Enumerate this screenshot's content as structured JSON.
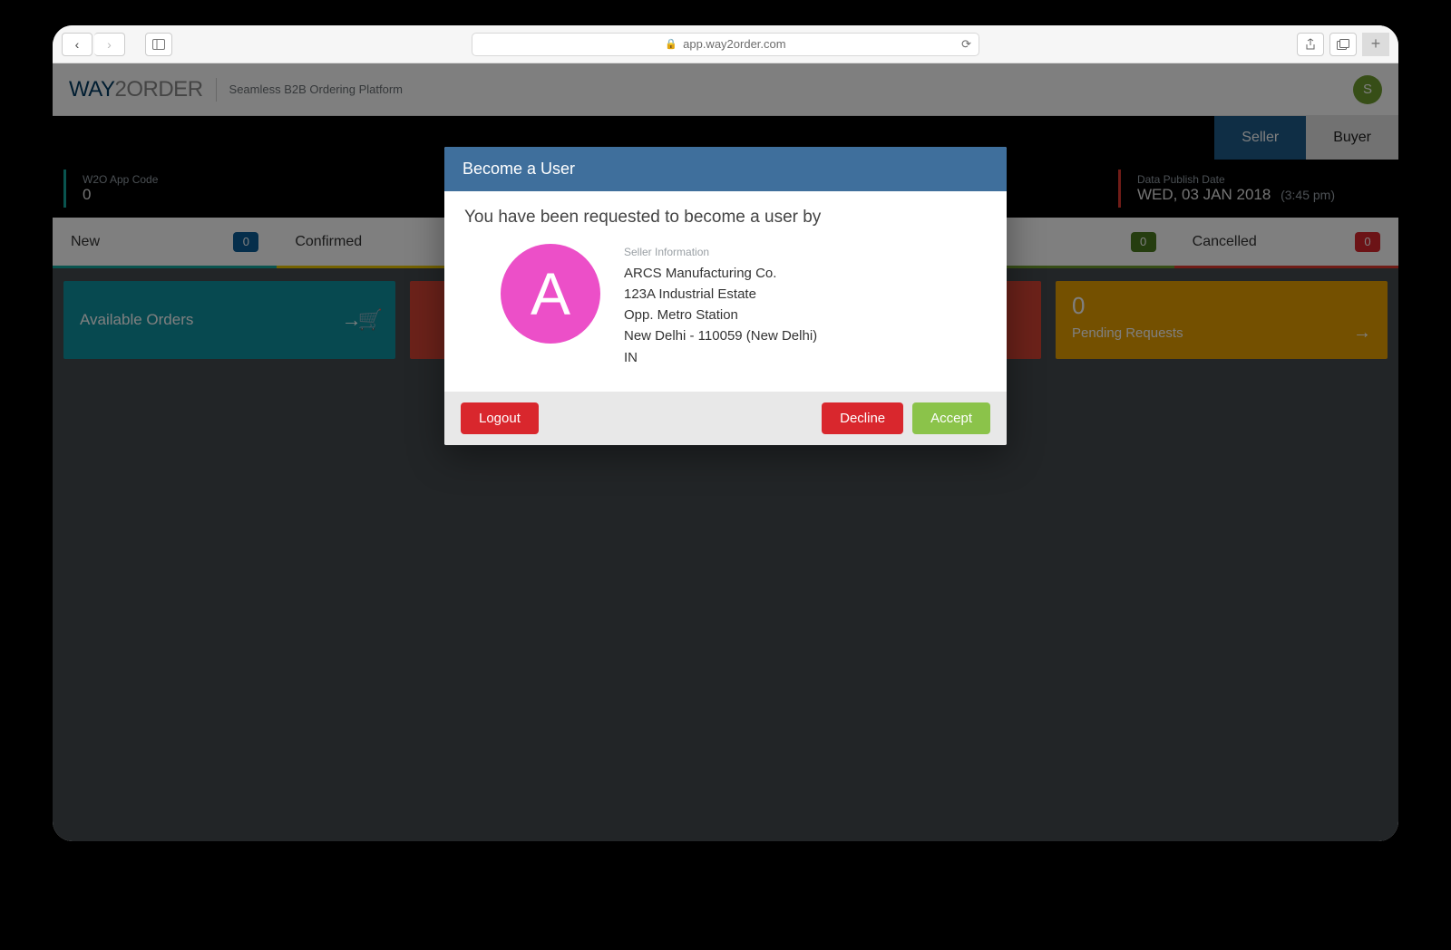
{
  "browser": {
    "address": "app.way2order.com"
  },
  "header": {
    "logo_main": "WAY",
    "logo_rest": "2ORDER",
    "tagline": "Seamless B2B Ordering Platform",
    "avatar_letter": "S"
  },
  "role_tabs": {
    "seller": "Seller",
    "buyer": "Buyer"
  },
  "info": {
    "app_code_label": "W2O App Code",
    "app_code_value": "0",
    "publish_label": "Data Publish Date",
    "publish_date": "WED, 03 JAN 2018",
    "publish_time": "(3:45 pm)"
  },
  "tabs": {
    "new": {
      "label": "New",
      "count": "0"
    },
    "confirmed": {
      "label": "Confirmed",
      "count": ""
    },
    "other_count": "0",
    "cancelled": {
      "label": "Cancelled",
      "count": "0"
    }
  },
  "tiles": {
    "available_label": "Available Orders",
    "pending_value": "0",
    "pending_label": "Pending Requests"
  },
  "modal": {
    "title": "Become a User",
    "message": "You have been requested to become a user by",
    "avatar_letter": "A",
    "seller_header": "Seller Information",
    "seller_name": "ARCS Manufacturing Co.",
    "addr1": "123A Industrial Estate",
    "addr2": "Opp. Metro Station",
    "addr3": "New Delhi - 110059 (New Delhi)",
    "country": "IN",
    "logout": "Logout",
    "decline": "Decline",
    "accept": "Accept"
  }
}
